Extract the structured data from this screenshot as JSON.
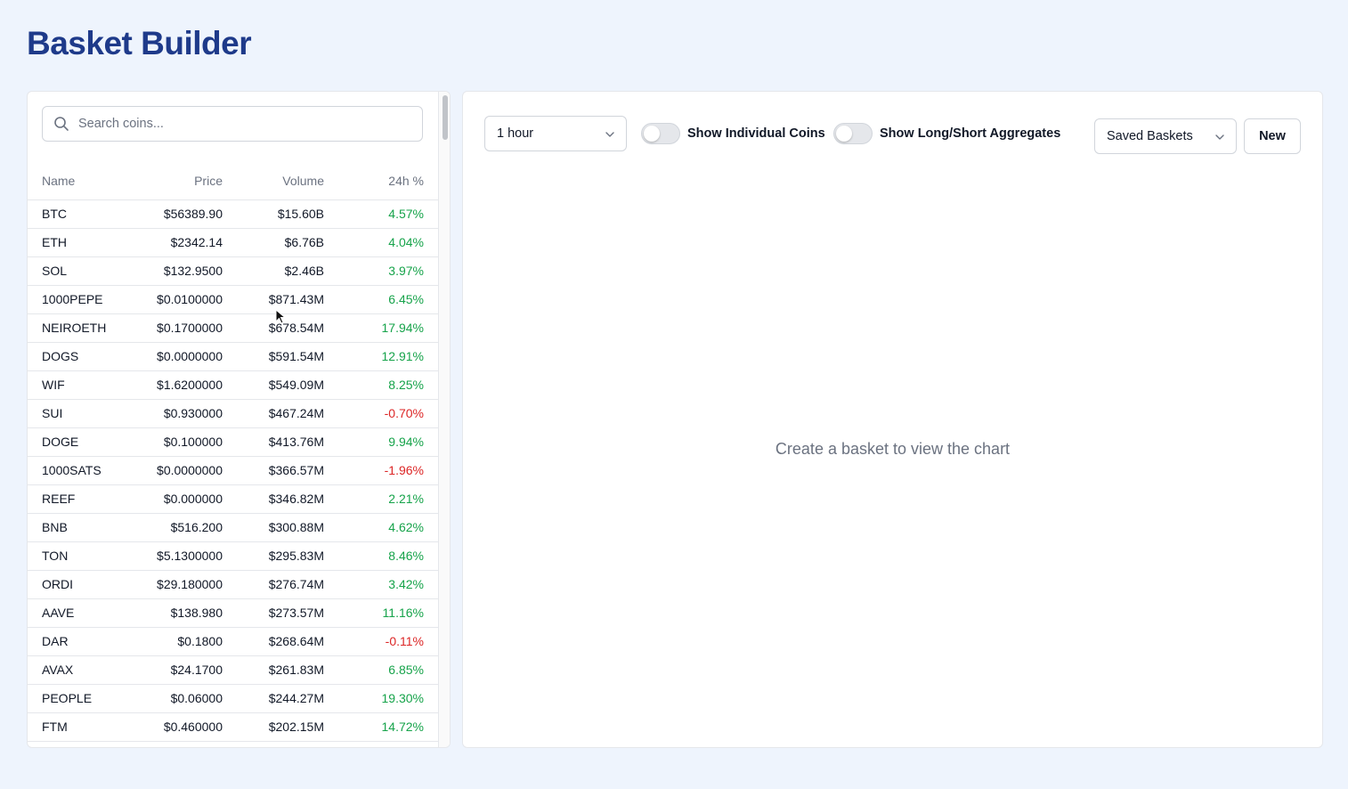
{
  "page": {
    "title": "Basket Builder"
  },
  "search": {
    "placeholder": "Search coins..."
  },
  "table": {
    "headers": {
      "name": "Name",
      "price": "Price",
      "volume": "Volume",
      "change": "24h %"
    },
    "rows": [
      {
        "name": "BTC",
        "price": "$56389.90",
        "volume": "$15.60B",
        "change": "4.57%",
        "direction": "up"
      },
      {
        "name": "ETH",
        "price": "$2342.14",
        "volume": "$6.76B",
        "change": "4.04%",
        "direction": "up"
      },
      {
        "name": "SOL",
        "price": "$132.9500",
        "volume": "$2.46B",
        "change": "3.97%",
        "direction": "up"
      },
      {
        "name": "1000PEPE",
        "price": "$0.0100000",
        "volume": "$871.43M",
        "change": "6.45%",
        "direction": "up"
      },
      {
        "name": "NEIROETH",
        "price": "$0.1700000",
        "volume": "$678.54M",
        "change": "17.94%",
        "direction": "up"
      },
      {
        "name": "DOGS",
        "price": "$0.0000000",
        "volume": "$591.54M",
        "change": "12.91%",
        "direction": "up"
      },
      {
        "name": "WIF",
        "price": "$1.6200000",
        "volume": "$549.09M",
        "change": "8.25%",
        "direction": "up"
      },
      {
        "name": "SUI",
        "price": "$0.930000",
        "volume": "$467.24M",
        "change": "-0.70%",
        "direction": "down"
      },
      {
        "name": "DOGE",
        "price": "$0.100000",
        "volume": "$413.76M",
        "change": "9.94%",
        "direction": "up"
      },
      {
        "name": "1000SATS",
        "price": "$0.0000000",
        "volume": "$366.57M",
        "change": "-1.96%",
        "direction": "down"
      },
      {
        "name": "REEF",
        "price": "$0.000000",
        "volume": "$346.82M",
        "change": "2.21%",
        "direction": "up"
      },
      {
        "name": "BNB",
        "price": "$516.200",
        "volume": "$300.88M",
        "change": "4.62%",
        "direction": "up"
      },
      {
        "name": "TON",
        "price": "$5.1300000",
        "volume": "$295.83M",
        "change": "8.46%",
        "direction": "up"
      },
      {
        "name": "ORDI",
        "price": "$29.180000",
        "volume": "$276.74M",
        "change": "3.42%",
        "direction": "up"
      },
      {
        "name": "AAVE",
        "price": "$138.980",
        "volume": "$273.57M",
        "change": "11.16%",
        "direction": "up"
      },
      {
        "name": "DAR",
        "price": "$0.1800",
        "volume": "$268.64M",
        "change": "-0.11%",
        "direction": "down"
      },
      {
        "name": "AVAX",
        "price": "$24.1700",
        "volume": "$261.83M",
        "change": "6.85%",
        "direction": "up"
      },
      {
        "name": "PEOPLE",
        "price": "$0.06000",
        "volume": "$244.27M",
        "change": "19.30%",
        "direction": "up"
      },
      {
        "name": "FTM",
        "price": "$0.460000",
        "volume": "$202.15M",
        "change": "14.72%",
        "direction": "up"
      }
    ]
  },
  "controls": {
    "timeframe": {
      "value": "1 hour"
    },
    "toggle_individual": {
      "label": "Show Individual Coins",
      "on": false
    },
    "toggle_aggregates": {
      "label": "Show Long/Short Aggregates",
      "on": false
    },
    "saved_baskets": {
      "value": "Saved Baskets"
    },
    "new_button": {
      "label": "New"
    }
  },
  "chart_area": {
    "empty_message": "Create a basket to view the chart"
  },
  "colors": {
    "title": "#1e3a8a",
    "positive": "#16a34a",
    "negative": "#dc2626",
    "background": "#eef4fd"
  },
  "icons": {
    "search": "search-icon",
    "dropdown": "chevron-down-icon"
  }
}
